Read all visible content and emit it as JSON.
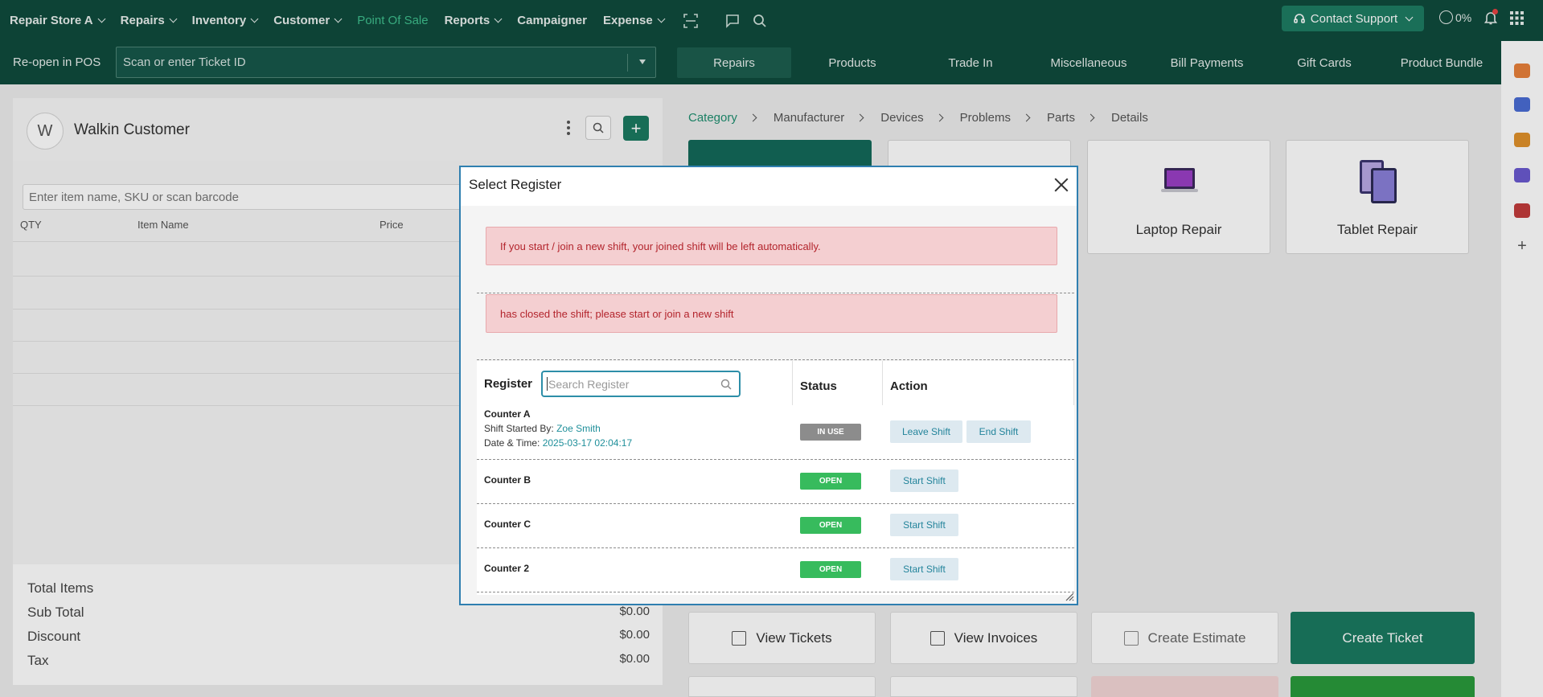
{
  "nav": {
    "items": [
      {
        "label": "Repair Store A",
        "dropdown": true,
        "active": false
      },
      {
        "label": "Repairs",
        "dropdown": true,
        "active": false
      },
      {
        "label": "Inventory",
        "dropdown": true,
        "active": false
      },
      {
        "label": "Customer",
        "dropdown": true,
        "active": false
      },
      {
        "label": "Point Of Sale",
        "dropdown": false,
        "active": true
      },
      {
        "label": "Reports",
        "dropdown": true,
        "active": false
      },
      {
        "label": "Campaigner",
        "dropdown": false,
        "active": false
      },
      {
        "label": "Expense",
        "dropdown": true,
        "active": false
      }
    ],
    "support_label": "Contact Support",
    "progress_label": "0%"
  },
  "pos_bar": {
    "reopen_label": "Re-open in POS",
    "ticket_placeholder": "Scan or enter Ticket ID",
    "tabs": [
      "Repairs",
      "Products",
      "Trade In",
      "Miscellaneous",
      "Bill Payments",
      "Gift Cards",
      "Product Bundle"
    ]
  },
  "customer": {
    "avatar_letter": "W",
    "name": "Walkin Customer"
  },
  "cart": {
    "search_placeholder": "Enter item name, SKU or scan barcode",
    "columns": {
      "qty": "QTY",
      "item_name": "Item Name",
      "price": "Price"
    }
  },
  "totals": {
    "total_items_label": "Total Items",
    "sub_total_label": "Sub Total",
    "sub_total_value": "$0.00",
    "discount_label": "Discount",
    "discount_value": "$0.00",
    "tax_label": "Tax",
    "tax_value": "$0.00"
  },
  "breadcrumb": [
    "Category",
    "Manufacturer",
    "Devices",
    "Problems",
    "Parts",
    "Details"
  ],
  "categories": {
    "laptop": "Laptop Repair",
    "tablet": "Tablet Repair"
  },
  "actions": {
    "view_tickets": "View Tickets",
    "view_invoices": "View Invoices",
    "create_estimate": "Create Estimate",
    "create_ticket": "Create Ticket"
  },
  "modal": {
    "title": "Select Register",
    "alert_1": "If you start / join a new shift, your joined shift will be left automatically.",
    "alert_2": "has closed the shift; please start or join a new shift",
    "headers": {
      "register": "Register",
      "status": "Status",
      "action": "Action"
    },
    "search_placeholder": "Search Register",
    "registers": [
      {
        "name": "Counter A",
        "shift_started_label": "Shift Started By:",
        "shift_started_by": "Zoe Smith",
        "datetime_label": "Date & Time:",
        "datetime": "2025-03-17 02:04:17",
        "status": "IN USE",
        "actions": [
          "Leave Shift",
          "End Shift"
        ]
      },
      {
        "name": "Counter B",
        "status": "OPEN",
        "actions": [
          "Start Shift"
        ]
      },
      {
        "name": "Counter C",
        "status": "OPEN",
        "actions": [
          "Start Shift"
        ]
      },
      {
        "name": "Counter 2",
        "status": "OPEN",
        "actions": [
          "Start Shift"
        ]
      }
    ]
  },
  "colors": {
    "nav_bg": "#0f4b3d",
    "accent": "#1a7a60",
    "open_badge": "#37bb5d",
    "in_use_badge": "#8c8c8c",
    "alert_bg": "#f4cfd1",
    "alert_text": "#b3242c"
  }
}
